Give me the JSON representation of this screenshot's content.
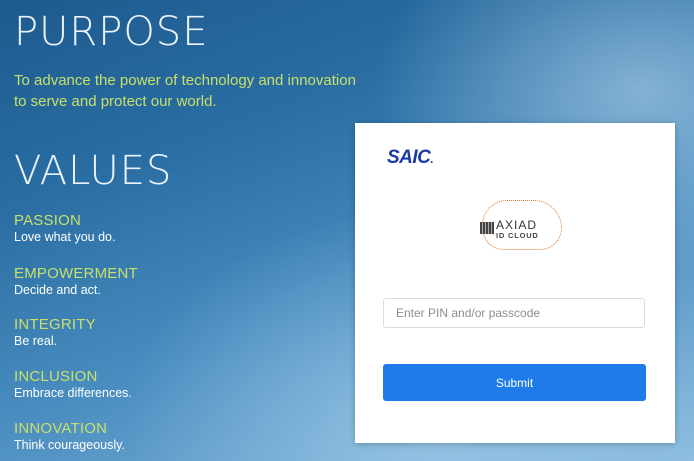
{
  "purpose": {
    "title": "PURPOSE",
    "text": "To advance the power of technology and innovation to serve and protect our world."
  },
  "values": {
    "title": "VALUES",
    "items": [
      {
        "name": "PASSION",
        "desc": "Love what you do."
      },
      {
        "name": "EMPOWERMENT",
        "desc": "Decide and act."
      },
      {
        "name": "INTEGRITY",
        "desc": "Be real."
      },
      {
        "name": "INCLUSION",
        "desc": "Embrace differences."
      },
      {
        "name": "INNOVATION",
        "desc": "Think courageously."
      }
    ]
  },
  "login": {
    "brand": "SAIC",
    "brand_dot": ".",
    "axiad_logo": {
      "word": "AXIAD",
      "sub": "ID CLOUD"
    },
    "pin_placeholder": "Enter PIN and/or passcode",
    "pin_value": "",
    "submit_label": "Submit"
  },
  "colors": {
    "accent_text": "#c8e06a",
    "button": "#1f7be8",
    "brand": "#1f3aa6"
  }
}
